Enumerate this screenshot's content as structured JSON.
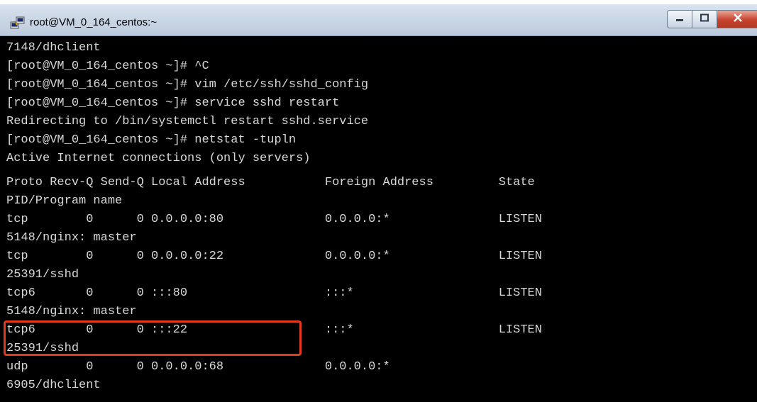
{
  "window": {
    "title": "root@VM_0_164_centos:~",
    "icons": {
      "app": "putty-icon",
      "minimize": "minimize-icon",
      "maximize": "maximize-icon",
      "close": "close-icon"
    },
    "colors": {
      "terminal_background": "#000000",
      "terminal_text": "#d8d8d8",
      "highlight": "#e23a1f"
    }
  },
  "terminal": {
    "lines": [
      "7148/dhclient",
      "[root@VM_0_164_centos ~]# ^C",
      "[root@VM_0_164_centos ~]# vim /etc/ssh/sshd_config",
      "[root@VM_0_164_centos ~]# service sshd restart",
      "Redirecting to /bin/systemctl restart sshd.service",
      "[root@VM_0_164_centos ~]# netstat -tupln",
      "Active Internet connections (only servers)",
      "Proto Recv-Q Send-Q Local Address           Foreign Address         State",
      "PID/Program name",
      "tcp        0      0 0.0.0.0:80              0.0.0.0:*               LISTEN",
      "5148/nginx: master",
      "tcp        0      0 0.0.0.0:22              0.0.0.0:*               LISTEN",
      "25391/sshd",
      "tcp6       0      0 :::80                   :::*                    LISTEN",
      "5148/nginx: master",
      "tcp6       0      0 :::22                   :::*                    LISTEN",
      "25391/sshd",
      "udp        0      0 0.0.0.0:68              0.0.0.0:*",
      "6905/dhclient"
    ]
  }
}
